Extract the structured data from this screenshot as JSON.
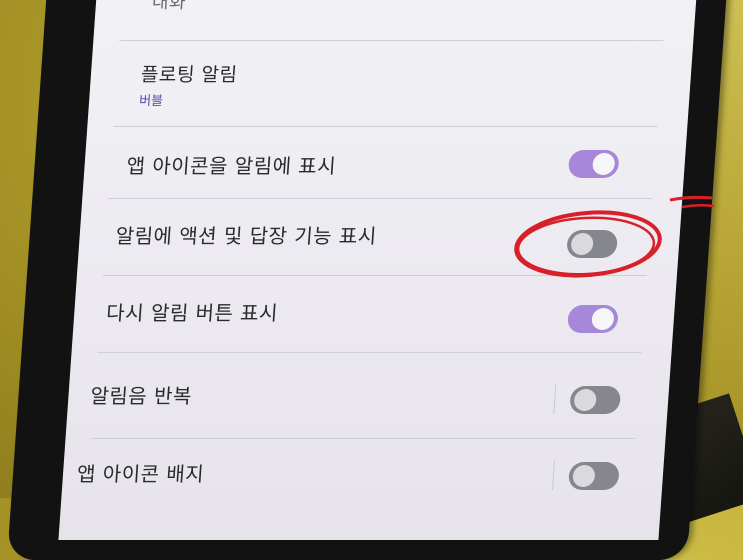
{
  "settings": {
    "row0_title": "대화",
    "row1": {
      "title": "플로팅 알림",
      "subtitle": "버블"
    },
    "row2": {
      "title": "앱 아이콘을 알림에 표시",
      "toggle_on": true
    },
    "row3": {
      "title": "알림에 액션 및 답장 기능 표시",
      "toggle_on": false
    },
    "row4": {
      "title": "다시 알림 버튼 표시",
      "toggle_on": true
    },
    "row5": {
      "title": "알림음 반복",
      "toggle_on": false
    },
    "row6": {
      "title": "앱 아이콘 배지",
      "toggle_on": false
    }
  },
  "colors": {
    "toggle_on": "#a787d9",
    "toggle_off": "#86868f",
    "subtitle": "#5f4aa8",
    "annotation": "#d8202a"
  },
  "annotation": {
    "icon": "red-circle-highlight"
  }
}
